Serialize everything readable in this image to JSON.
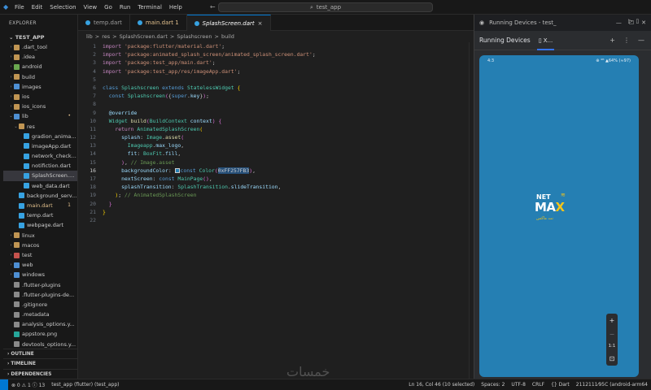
{
  "titlebar": {
    "menu": [
      "File",
      "Edit",
      "Selection",
      "View",
      "Go",
      "Run",
      "Terminal",
      "Help"
    ],
    "search": "test_app"
  },
  "sidebar": {
    "header": "EXPLORER",
    "root": "TEST_APP",
    "items": [
      {
        "label": ".dart_tool",
        "level": 1,
        "type": "folder"
      },
      {
        "label": ".idea",
        "level": 1,
        "type": "folder"
      },
      {
        "label": "android",
        "level": 1,
        "type": "folder-green"
      },
      {
        "label": "build",
        "level": 1,
        "type": "folder"
      },
      {
        "label": "images",
        "level": 1,
        "type": "folder-blue"
      },
      {
        "label": "ios",
        "level": 1,
        "type": "folder"
      },
      {
        "label": "ios_icons",
        "level": 1,
        "type": "folder"
      },
      {
        "label": "lib",
        "level": 1,
        "type": "folder-blue",
        "open": true,
        "badge": "•"
      },
      {
        "label": "res",
        "level": 2,
        "type": "folder",
        "open": true
      },
      {
        "label": "gradion_animat...",
        "level": 3,
        "type": "dart"
      },
      {
        "label": "imageApp.dart",
        "level": 3,
        "type": "dart"
      },
      {
        "label": "network_check...",
        "level": 3,
        "type": "dart"
      },
      {
        "label": "notifiction.dart",
        "level": 3,
        "type": "dart"
      },
      {
        "label": "SplashScreen.d...",
        "level": 3,
        "type": "dart",
        "selected": true
      },
      {
        "label": "web_data.dart",
        "level": 3,
        "type": "dart"
      },
      {
        "label": "background_serv...",
        "level": 2,
        "type": "dart"
      },
      {
        "label": "main.dart",
        "level": 2,
        "type": "dart",
        "badge": "1",
        "modified": true
      },
      {
        "label": "temp.dart",
        "level": 2,
        "type": "dart"
      },
      {
        "label": "webpage.dart",
        "level": 2,
        "type": "dart"
      },
      {
        "label": "linux",
        "level": 1,
        "type": "folder"
      },
      {
        "label": "macos",
        "level": 1,
        "type": "folder"
      },
      {
        "label": "test",
        "level": 1,
        "type": "folder-red"
      },
      {
        "label": "web",
        "level": 1,
        "type": "folder-blue"
      },
      {
        "label": "windows",
        "level": 1,
        "type": "folder-blue"
      },
      {
        "label": ".flutter-plugins",
        "level": 1,
        "type": "file"
      },
      {
        "label": ".flutter-plugins-de...",
        "level": 1,
        "type": "file"
      },
      {
        "label": ".gitignore",
        "level": 1,
        "type": "file"
      },
      {
        "label": ".metadata",
        "level": 1,
        "type": "file"
      },
      {
        "label": "analysis_options.y...",
        "level": 1,
        "type": "file"
      },
      {
        "label": "appstore.png",
        "level": 1,
        "type": "img"
      },
      {
        "label": "devtools_options.y...",
        "level": 1,
        "type": "file"
      }
    ],
    "sections": [
      "OUTLINE",
      "TIMELINE",
      "DEPENDENCIES"
    ]
  },
  "editor": {
    "tabs": [
      {
        "label": "temp.dart",
        "state": ""
      },
      {
        "label": "main.dart 1",
        "state": "modified"
      },
      {
        "label": "SplashScreen.dart",
        "state": "active"
      }
    ],
    "breadcrumb": [
      "lib",
      ">",
      "res",
      ">",
      "SplashScreen.dart",
      ">",
      "Splashscreen",
      ">",
      "build"
    ],
    "current_line": 16
  },
  "devices": {
    "window_title": "Running Devices - test_",
    "tab_title": "Running Devices",
    "device_tab": "X...",
    "phone_time": "4:3",
    "phone_status_right": "⊕ ⁴ᴳ ▲64% (≈97)",
    "phone_bg": "#257fb3",
    "logo_net": "NET",
    "logo_max_a": "MA",
    "logo_max_b": "X",
    "logo_sub": "نت ماكس",
    "zoom_in": "+",
    "zoom_out": "−",
    "zoom_reset": "1:1"
  },
  "statusbar": {
    "left": [
      "⊗ 0 ⚠ 1 ⓘ 13",
      "test_app (flutter) (test_app)"
    ],
    "right": [
      "Ln 16, Col 46 (10 selected)",
      "Spaces: 2",
      "UTF-8",
      "CRLF",
      "{} Dart",
      "2112111⁄95C (android-arm64"
    ]
  },
  "watermark": "خمسات"
}
